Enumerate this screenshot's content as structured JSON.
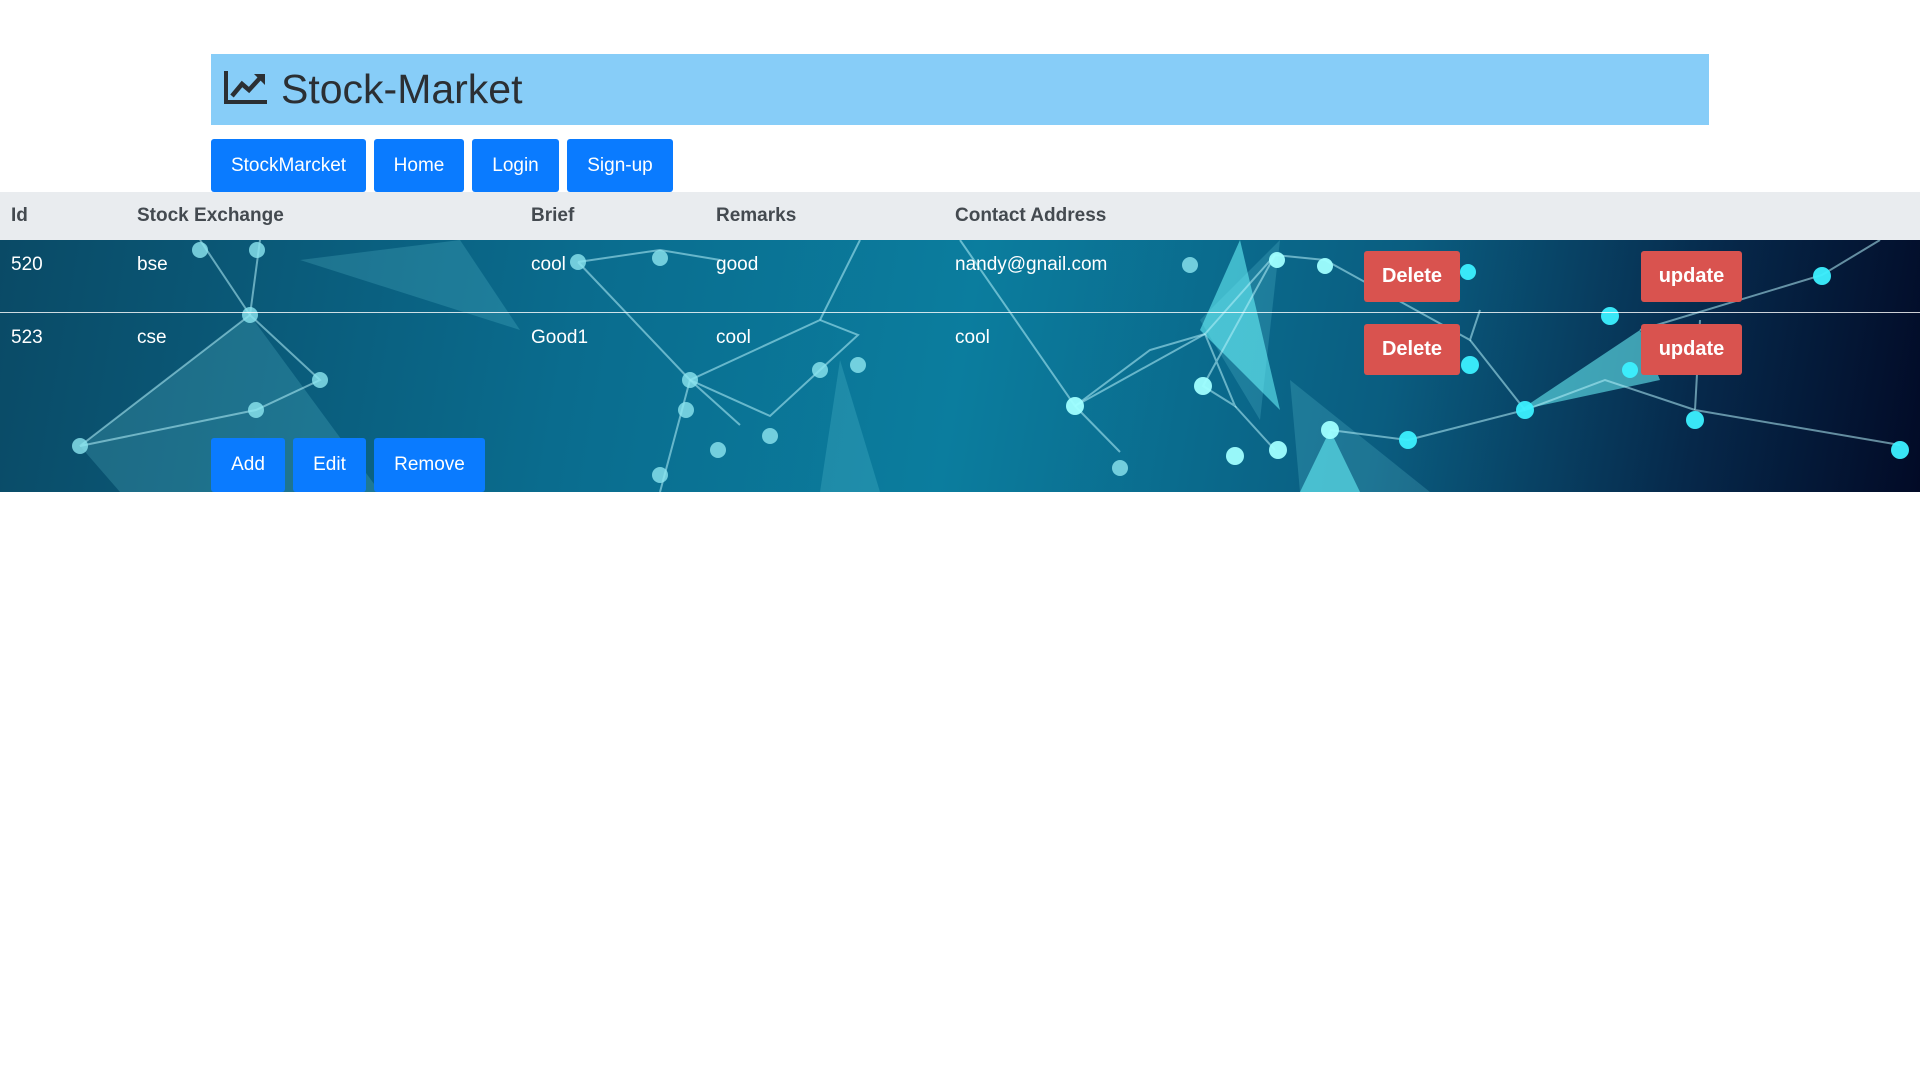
{
  "header": {
    "title": "Stock-Market",
    "icon": "chart-line-icon"
  },
  "nav": [
    "StockMarcket",
    "Home",
    "Login",
    "Sign-up"
  ],
  "table": {
    "columns": [
      "Id",
      "Stock Exchange",
      "Brief",
      "Remarks",
      "Contact Address"
    ],
    "rows": [
      {
        "id": "520",
        "exchange": "bse",
        "brief": "cool",
        "remarks": "good",
        "contact": "nandy@gnail.com",
        "delete_label": "Delete",
        "update_label": "update"
      },
      {
        "id": "523",
        "exchange": "cse",
        "brief": "Good1",
        "remarks": "cool",
        "contact": "cool",
        "delete_label": "Delete",
        "update_label": "update"
      }
    ]
  },
  "actions": [
    "Add",
    "Edit",
    "Remove"
  ],
  "colors": {
    "header_bg": "#87cdf8",
    "primary_button": "#0a7bff",
    "danger_button": "#d9534f",
    "table_header_bg": "#e9ecef"
  }
}
